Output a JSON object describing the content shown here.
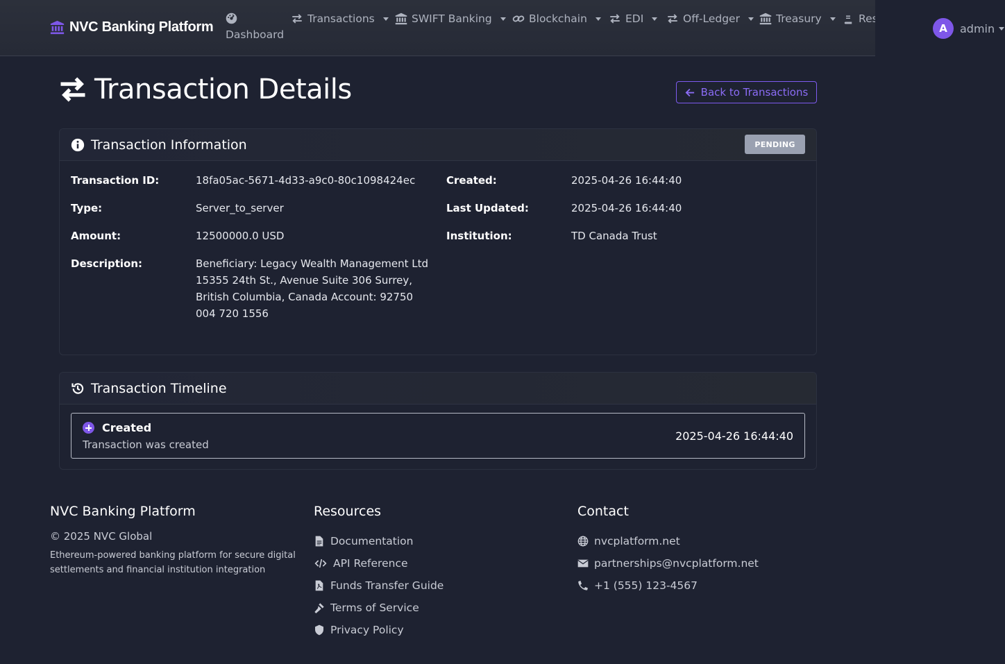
{
  "nav": {
    "brand": "NVC Banking Platform",
    "dashboard": "Dashboard",
    "items": [
      {
        "label": "Transactions",
        "icon": "exchange-icon"
      },
      {
        "label": "SWIFT Banking",
        "icon": "bank-icon"
      },
      {
        "label": "Blockchain",
        "icon": "link-icon"
      },
      {
        "label": "EDI",
        "icon": "exchange-icon"
      },
      {
        "label": "Off-Ledger",
        "icon": "exchange-icon"
      },
      {
        "label": "Treasury",
        "icon": "bank-icon"
      },
      {
        "label": "Resources",
        "icon": "book-icon"
      }
    ],
    "user": {
      "initial": "A",
      "name": "admin"
    }
  },
  "page": {
    "title": "Transaction Details",
    "back_button": "Back to Transactions"
  },
  "info_card": {
    "title": "Transaction Information",
    "status": "PENDING",
    "fields": {
      "id_label": "Transaction ID:",
      "id_value": "18fa05ac-5671-4d33-a9c0-80c1098424ec",
      "type_label": "Type:",
      "type_value": "Server_to_server",
      "amount_label": "Amount:",
      "amount_value": "12500000.0 USD",
      "description_label": "Description:",
      "description_value": "Beneficiary: Legacy Wealth Management Ltd 15355 24th St., Avenue Suite 306 Surrey, British Columbia, Canada Account: 92750 004 720 1556",
      "created_label": "Created:",
      "created_value": "2025-04-26 16:44:40",
      "updated_label": "Last Updated:",
      "updated_value": "2025-04-26 16:44:40",
      "institution_label": "Institution:",
      "institution_value": "TD Canada Trust"
    }
  },
  "timeline": {
    "title": "Transaction Timeline",
    "events": [
      {
        "title": "Created",
        "subtitle": "Transaction was created",
        "time": "2025-04-26 16:44:40"
      }
    ]
  },
  "footer": {
    "col1": {
      "heading": "NVC Banking Platform",
      "copyright": "© 2025 NVC Global",
      "tagline": "Ethereum-powered banking platform for secure digital settlements and financial institution integration"
    },
    "col2": {
      "heading": "Resources",
      "links": [
        "Documentation",
        "API Reference",
        "Funds Transfer Guide",
        "Terms of Service",
        "Privacy Policy"
      ]
    },
    "col3": {
      "heading": "Contact",
      "links": [
        "nvcplatform.net",
        "partnerships@nvcplatform.net",
        "+1 (555) 123-4567"
      ]
    }
  },
  "colors": {
    "background": "#1e2231",
    "accent": "#7e57e8",
    "badge": "#9aa1b1"
  }
}
